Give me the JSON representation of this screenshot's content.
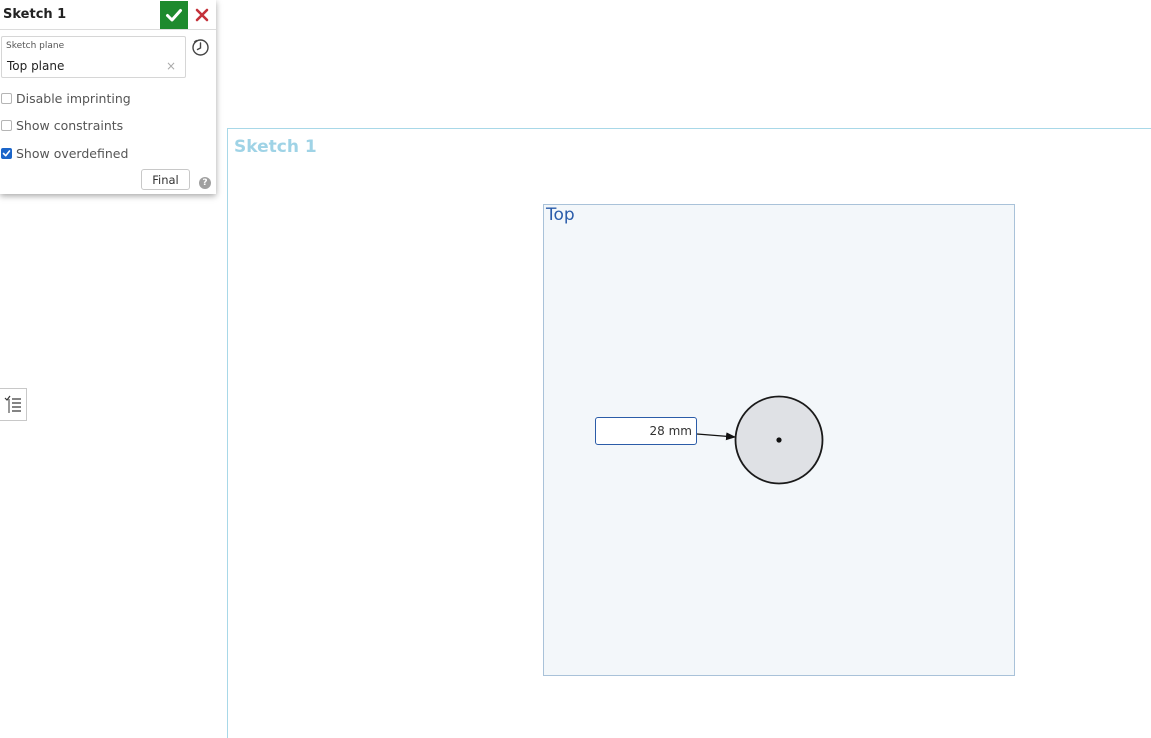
{
  "dialog": {
    "title": "Sketch 1",
    "sketch_plane_label": "Sketch plane",
    "sketch_plane_value": "Top plane",
    "clear_glyph": "×",
    "checkboxes": [
      {
        "label": "Disable imprinting",
        "checked": false
      },
      {
        "label": "Show constraints",
        "checked": false
      },
      {
        "label": "Show overdefined",
        "checked": true
      }
    ],
    "final_label": "Final",
    "help_glyph": "?",
    "icons": {
      "accept": "check-icon",
      "cancel": "close-icon",
      "history": "clock-icon",
      "help": "help-icon"
    },
    "colors": {
      "accept_bg": "#1e8a2e",
      "cancel": "#c4313a",
      "checkbox_checked": "#1b65c9"
    }
  },
  "sidebar": {
    "list_toggle_icon": "list-icon"
  },
  "viewport": {
    "sketch_name": "Sketch 1",
    "plane_name": "Top",
    "dimension_value": "28 mm",
    "colors": {
      "sketch_label": "#9fd3e6",
      "plane_label": "#2a5caa",
      "plane_fill": "#f3f7fa",
      "circle_fill": "#dfe1e5"
    }
  }
}
